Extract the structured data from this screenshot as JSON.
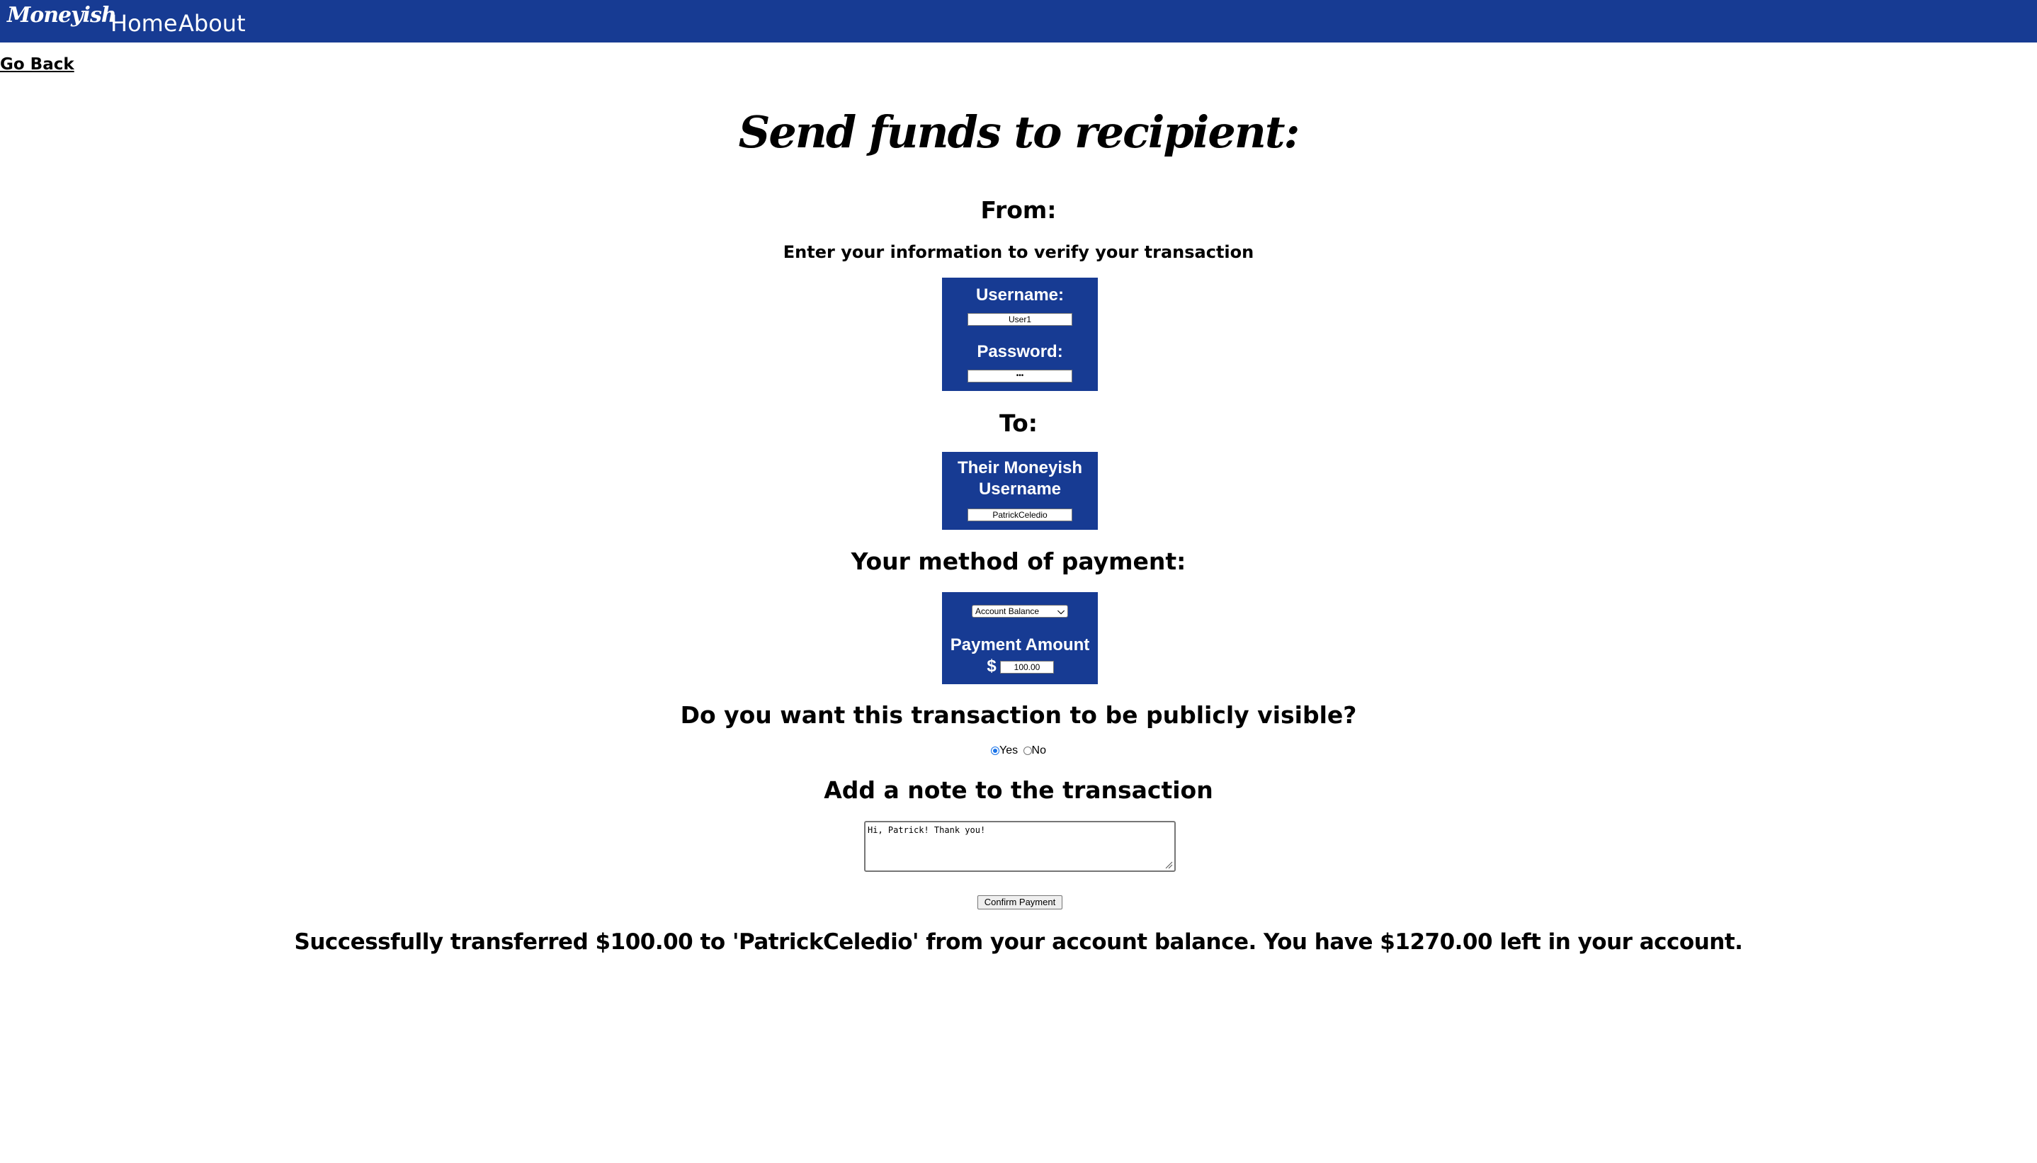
{
  "nav": {
    "logo": "Moneyish",
    "links": [
      "Home",
      "About"
    ]
  },
  "go_back": "Go Back",
  "title": "Send funds to recipient:",
  "from": {
    "heading": "From:",
    "subheading": "Enter your information to verify your transaction",
    "username_label": "Username:",
    "username_value": "User1",
    "password_label": "Password:",
    "password_value": "•••"
  },
  "to": {
    "heading": "To:",
    "recipient_label_line1": "Their Moneyish",
    "recipient_label_line2": "Username",
    "recipient_value": "PatrickCeledio"
  },
  "payment": {
    "heading": "Your method of payment:",
    "method_selected": "Account Balance",
    "amount_label": "Payment Amount",
    "currency": "$",
    "amount_value": "100.00"
  },
  "visibility": {
    "heading": "Do you want this transaction to be publicly visible?",
    "options": [
      "Yes",
      "No"
    ],
    "selected": "Yes"
  },
  "note": {
    "heading": "Add a note to the transaction",
    "value": "Hi, Patrick! Thank you!"
  },
  "confirm_label": "Confirm Payment",
  "success_message": "Successfully transferred $100.00 to 'PatrickCeledio' from your account balance. You have $1270.00 left in your account.",
  "colors": {
    "brand": "#173b93",
    "radio_accent": "#1a73e8"
  }
}
